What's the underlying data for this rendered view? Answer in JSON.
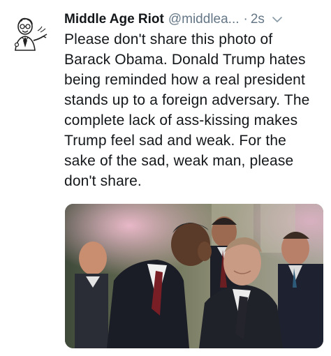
{
  "tweet": {
    "display_name": "Middle Age Riot",
    "handle": "@middlea...",
    "separator": "·",
    "time": "2s",
    "text": "Please don't share this photo of Barack Obama. Donald Trump hates being reminded how a real president stands up to a foreign adversary. The complete lack of ass-kissing makes Trump feel sad and weak. For the sake of the sad, weak man, please don't share.",
    "avatar_icon": "cartoon-man-pointing-avatar",
    "menu_icon": "chevron-down-icon",
    "media_icon": "photo"
  },
  "colors": {
    "text": "#14171a",
    "secondary_text": "#657786",
    "background": "#ffffff"
  }
}
